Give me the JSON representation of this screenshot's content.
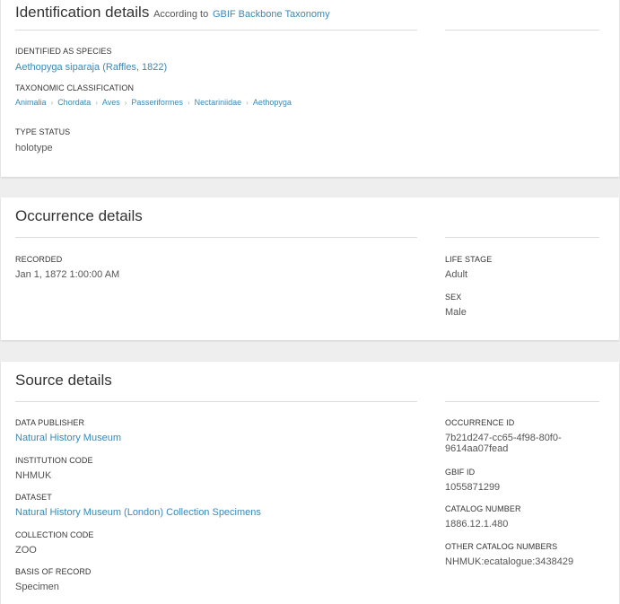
{
  "identification": {
    "title": "Identification details",
    "according_prefix": "According to",
    "according_link": "GBIF Backbone Taxonomy",
    "identified_as_label": "Identified as species",
    "identified_as_value": "Aethopyga siparaja (Raffles, 1822)",
    "taxonomic_label": "Taxonomic classification",
    "taxonomy": [
      "Animalia",
      "Chordata",
      "Aves",
      "Passeriformes",
      "Nectariniidae",
      "Aethopyga"
    ],
    "type_status_label": "Type status",
    "type_status_value": "holotype"
  },
  "occurrence": {
    "title": "Occurrence details",
    "recorded_label": "Recorded",
    "recorded_value": "Jan 1, 1872 1:00:00 AM",
    "life_stage_label": "Life stage",
    "life_stage_value": "Adult",
    "sex_label": "Sex",
    "sex_value": "Male"
  },
  "source": {
    "title": "Source details",
    "data_publisher_label": "Data publisher",
    "data_publisher_value": "Natural History Museum",
    "institution_code_label": "Institution code",
    "institution_code_value": "NHMUK",
    "dataset_label": "Dataset",
    "dataset_value": "Natural History Museum (London) Collection Specimens",
    "collection_code_label": "Collection code",
    "collection_code_value": "ZOO",
    "basis_label": "Basis of record",
    "basis_value": "Specimen",
    "occurrence_id_label": "Occurrence ID",
    "occurrence_id_value": "7b21d247-cc65-4f98-80f0-9614aa07fead",
    "gbif_id_label": "GBIF ID",
    "gbif_id_value": "1055871299",
    "catalog_number_label": "Catalog number",
    "catalog_number_value": "1886.12.1.480",
    "other_catalog_label": "Other catalog numbers",
    "other_catalog_value": "NHMUK:ecatalogue:3438429"
  },
  "colors": {
    "link": "#3a88b5",
    "background": "#eeeeee",
    "card": "#ffffff"
  }
}
